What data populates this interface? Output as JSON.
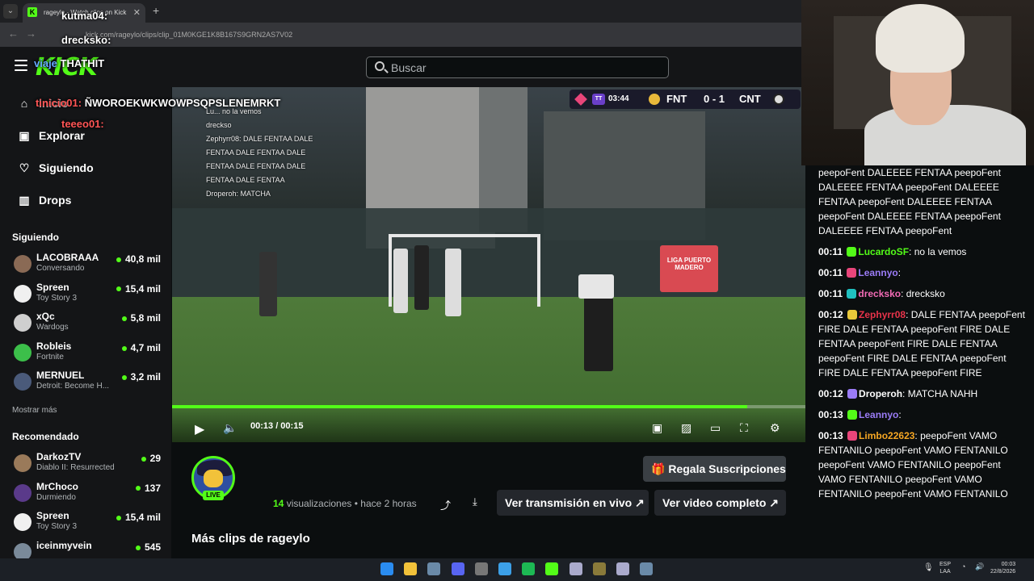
{
  "browser": {
    "tab_title": "rageylo - Watch clips on Kick",
    "url": "kick.com/rageylo/clips/clip_01M0KGE1K8B167S9GRN2AS7V02"
  },
  "header": {
    "logo": "KICK",
    "search_placeholder": "Buscar"
  },
  "sidebar": {
    "nav": [
      {
        "label": "Inicio",
        "icon": "home-icon"
      },
      {
        "label": "Explorar",
        "icon": "explore-icon"
      },
      {
        "label": "Siguiendo",
        "icon": "heart-icon"
      },
      {
        "label": "Drops",
        "icon": "drops-icon"
      }
    ],
    "following_title": "Siguiendo",
    "following": [
      {
        "name": "LACOBRAAA",
        "game": "Conversando",
        "viewers": "40,8 mil",
        "color": "#8a6a55"
      },
      {
        "name": "Spreen",
        "game": "Toy Story 3",
        "viewers": "15,4 mil",
        "color": "#f0f0f0"
      },
      {
        "name": "xQc",
        "game": "Wardogs",
        "viewers": "5,8 mil",
        "color": "#cfcfcf"
      },
      {
        "name": "Robleis",
        "game": "Fortnite",
        "viewers": "4,7 mil",
        "color": "#3cbf4a"
      },
      {
        "name": "MERNUEL",
        "game": "Detroit: Become H...",
        "viewers": "3,2 mil",
        "color": "#4a5a7a"
      }
    ],
    "show_more": "Mostrar más",
    "recommended_title": "Recomendado",
    "recommended": [
      {
        "name": "DarkozTV",
        "game": "Diablo II: Resurrected",
        "viewers": "29",
        "color": "#9a7a5a"
      },
      {
        "name": "MrChoco",
        "game": "Durmiendo",
        "viewers": "137",
        "color": "#5a3a8a"
      },
      {
        "name": "Spreen",
        "game": "Toy Story 3",
        "viewers": "15,4 mil",
        "color": "#f0f0f0"
      },
      {
        "name": "iceinmyvein",
        "game": "",
        "viewers": "545",
        "color": "#7a8a9a"
      }
    ]
  },
  "video": {
    "scoreboard": {
      "time": "03:44",
      "team1": "FNT",
      "score": "0 - 1",
      "team2": "CNT"
    },
    "overlay_chat": [
      "Lu... no la vemos",
      "dreckso",
      "Zephyrr08: DALE FENTAA DALE",
      "FENTAA DALE FENTAA DALE",
      "FENTAA DALE FENTAA DALE",
      "FENTAA DALE FENTAA",
      "Droperoh: MATCHA"
    ],
    "banner": "LIGA PUERTO MADERO",
    "current_time": "00:13",
    "duration": "00:15",
    "timecode": "00:13 / 00:15",
    "progress_fraction": 0.908
  },
  "clip_info": {
    "live_badge": "LIVE",
    "views_count": "14",
    "views_suffix": " visualizaciones • hace 2 horas",
    "gift_label": "Regala Suscripciones",
    "live_label": "Ver transmisión en vivo",
    "full_label": "Ver video completo",
    "more_clips": "Más clips de rageylo"
  },
  "chat": {
    "top_text": "peepoFent DALEEEE FENTAA peepoFent DALEEEE FENTAA peepoFent DALEEEE FENTAA peepoFent DALEEEE FENTAA peepoFent DALEEEE FENTAA peepoFent DALEEEE FENTAA peepoFent",
    "messages": [
      {
        "ts": "00:11",
        "user": "LucardoSF",
        "color": "#53fc18",
        "text": ": no la vemos"
      },
      {
        "ts": "00:11",
        "user": "Leannyo",
        "color": "#9b7cf7",
        "text": ": "
      },
      {
        "ts": "00:11",
        "user": "drecksko",
        "color": "#f26bb5",
        "text": ": drecksko"
      },
      {
        "ts": "00:12",
        "user": "Zephyrr08",
        "color": "#e8334a",
        "text": ": DALE FENTAA peepoFent FIRE DALE FENTAA peepoFent FIRE DALE FENTAA peepoFent FIRE DALE FENTAA peepoFent FIRE DALE FENTAA peepoFent FIRE DALE FENTAA peepoFent FIRE"
      },
      {
        "ts": "00:12",
        "user": "Droperoh",
        "color": "#ffffff",
        "text": ": MATCHA NAHH"
      },
      {
        "ts": "00:13",
        "user": "Leannyo",
        "color": "#9b7cf7",
        "text": ": "
      },
      {
        "ts": "00:13",
        "user": "Limbo22623",
        "color": "#f5a623",
        "text": ": peepoFent VAMO FENTANILO peepoFent VAMO FENTANILO peepoFent VAMO FENTANILO peepoFent VAMO FENTANILO peepoFent VAMO FENTANILO peepoFent VAMO FENTANILO"
      }
    ]
  },
  "stream_overlay": {
    "lines": [
      {
        "user": "kutma04:",
        "text": ""
      },
      {
        "user": "drecksko:",
        "text": ""
      },
      {
        "user": "viaje",
        "text": "THATHIT"
      },
      {
        "user": "tinicio01:",
        "text": "ÑWOROEKWKWOWPSQPSLENEMRKT"
      },
      {
        "user": "teeeo01:",
        "text": ""
      }
    ]
  },
  "taskbar": {
    "lang1": "ESP",
    "lang2": "LAA",
    "time": "00:03",
    "date": "22/8/2026"
  }
}
